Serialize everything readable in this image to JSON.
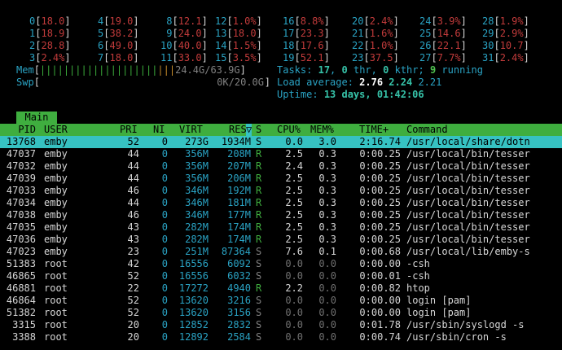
{
  "cpus": [
    {
      "id": "0",
      "val": "18.0"
    },
    {
      "id": "1",
      "val": "18.9"
    },
    {
      "id": "2",
      "val": "28.8"
    },
    {
      "id": "3",
      "val": "2.4%"
    },
    {
      "id": "4",
      "val": "19.0"
    },
    {
      "id": "5",
      "val": "38.2"
    },
    {
      "id": "6",
      "val": "49.0"
    },
    {
      "id": "7",
      "val": "18.0"
    },
    {
      "id": "8",
      "val": "12.1"
    },
    {
      "id": "9",
      "val": "24.0"
    },
    {
      "id": "10",
      "val": "40.0"
    },
    {
      "id": "11",
      "val": "33.0"
    },
    {
      "id": "12",
      "val": "1.0%"
    },
    {
      "id": "13",
      "val": "18.0"
    },
    {
      "id": "14",
      "val": "1.5%"
    },
    {
      "id": "15",
      "val": "3.5%"
    },
    {
      "id": "16",
      "val": "8.8%"
    },
    {
      "id": "17",
      "val": "23.3"
    },
    {
      "id": "18",
      "val": "17.6"
    },
    {
      "id": "19",
      "val": "52.1"
    },
    {
      "id": "20",
      "val": "2.4%"
    },
    {
      "id": "21",
      "val": "1.6%"
    },
    {
      "id": "22",
      "val": "1.0%"
    },
    {
      "id": "23",
      "val": "37.5"
    },
    {
      "id": "24",
      "val": "3.9%"
    },
    {
      "id": "25",
      "val": "14.6"
    },
    {
      "id": "26",
      "val": "22.1"
    },
    {
      "id": "27",
      "val": "7.7%"
    },
    {
      "id": "28",
      "val": "1.9%"
    },
    {
      "id": "29",
      "val": "2.9%"
    },
    {
      "id": "30",
      "val": "10.7"
    },
    {
      "id": "31",
      "val": "2.4%"
    }
  ],
  "mem": {
    "label": "Mem",
    "bars": "||||||||||||||||||||",
    "bars2": "|||",
    "value": "24.4G/63.9G"
  },
  "swp": {
    "label": "Swp",
    "value": "0K/20.0G"
  },
  "tasks": {
    "label": "Tasks:",
    "count": "17",
    "sep1": ",",
    "thr": "0",
    "thr_label": "thr,",
    "kthr": "0",
    "kthr_label": "kthr;",
    "running": "9",
    "running_label": "running"
  },
  "load": {
    "label": "Load average:",
    "l1": "2.76",
    "l5": "2.24",
    "l15": "2.21"
  },
  "uptime": {
    "label": "Uptime:",
    "value": "13 days, 01:42:06"
  },
  "tab": {
    "label": "Main"
  },
  "header": {
    "pid": "PID",
    "user": "USER",
    "pri": "PRI",
    "ni": "NI",
    "virt": "VIRT",
    "res": "RES",
    "sort": "▽",
    "s": "S",
    "cpu": "CPU%",
    "mem": "MEM%",
    "time": "TIME+",
    "cmd": "Command"
  },
  "processes": [
    {
      "pid": "13768",
      "user": "emby",
      "pri": "52",
      "ni": "0",
      "virt": "273G",
      "res": "1934M",
      "s": "S",
      "cpu": "0.0",
      "mem": "3.0",
      "time": "2:16.74",
      "cmd": "/usr/local/share/dotn"
    },
    {
      "pid": "47037",
      "user": "emby",
      "pri": "44",
      "ni": "0",
      "virt": "356M",
      "res": "208M",
      "s": "R",
      "cpu": "2.5",
      "mem": "0.3",
      "time": "0:00.25",
      "cmd": "/usr/local/bin/tesser"
    },
    {
      "pid": "47032",
      "user": "emby",
      "pri": "44",
      "ni": "0",
      "virt": "356M",
      "res": "207M",
      "s": "R",
      "cpu": "2.4",
      "mem": "0.3",
      "time": "0:00.25",
      "cmd": "/usr/local/bin/tesser"
    },
    {
      "pid": "47039",
      "user": "emby",
      "pri": "44",
      "ni": "0",
      "virt": "356M",
      "res": "206M",
      "s": "R",
      "cpu": "2.5",
      "mem": "0.3",
      "time": "0:00.25",
      "cmd": "/usr/local/bin/tesser"
    },
    {
      "pid": "47033",
      "user": "emby",
      "pri": "46",
      "ni": "0",
      "virt": "346M",
      "res": "192M",
      "s": "R",
      "cpu": "2.5",
      "mem": "0.3",
      "time": "0:00.25",
      "cmd": "/usr/local/bin/tesser"
    },
    {
      "pid": "47034",
      "user": "emby",
      "pri": "44",
      "ni": "0",
      "virt": "346M",
      "res": "181M",
      "s": "R",
      "cpu": "2.5",
      "mem": "0.3",
      "time": "0:00.25",
      "cmd": "/usr/local/bin/tesser"
    },
    {
      "pid": "47038",
      "user": "emby",
      "pri": "46",
      "ni": "0",
      "virt": "346M",
      "res": "177M",
      "s": "R",
      "cpu": "2.5",
      "mem": "0.3",
      "time": "0:00.25",
      "cmd": "/usr/local/bin/tesser"
    },
    {
      "pid": "47035",
      "user": "emby",
      "pri": "43",
      "ni": "0",
      "virt": "282M",
      "res": "174M",
      "s": "R",
      "cpu": "2.5",
      "mem": "0.3",
      "time": "0:00.25",
      "cmd": "/usr/local/bin/tesser"
    },
    {
      "pid": "47036",
      "user": "emby",
      "pri": "43",
      "ni": "0",
      "virt": "282M",
      "res": "174M",
      "s": "R",
      "cpu": "2.5",
      "mem": "0.3",
      "time": "0:00.25",
      "cmd": "/usr/local/bin/tesser"
    },
    {
      "pid": "47023",
      "user": "emby",
      "pri": "23",
      "ni": "0",
      "virt": "251M",
      "res": "87364",
      "s": "S",
      "cpu": "7.6",
      "mem": "0.1",
      "time": "0:00.68",
      "cmd": "/usr/local/lib/emby-s"
    },
    {
      "pid": "51383",
      "user": "root",
      "pri": "42",
      "ni": "0",
      "virt": "16556",
      "res": "6092",
      "s": "S",
      "cpu": "0.0",
      "mem": "0.0",
      "time": "0:00.00",
      "cmd": "-csh"
    },
    {
      "pid": "46865",
      "user": "root",
      "pri": "52",
      "ni": "0",
      "virt": "16556",
      "res": "6032",
      "s": "S",
      "cpu": "0.0",
      "mem": "0.0",
      "time": "0:00.01",
      "cmd": "-csh"
    },
    {
      "pid": "46881",
      "user": "root",
      "pri": "22",
      "ni": "0",
      "virt": "17272",
      "res": "4940",
      "s": "R",
      "cpu": "2.2",
      "mem": "0.0",
      "time": "0:00.82",
      "cmd": "htop"
    },
    {
      "pid": "46864",
      "user": "root",
      "pri": "52",
      "ni": "0",
      "virt": "13620",
      "res": "3216",
      "s": "S",
      "cpu": "0.0",
      "mem": "0.0",
      "time": "0:00.00",
      "cmd": "login [pam]"
    },
    {
      "pid": "51382",
      "user": "root",
      "pri": "52",
      "ni": "0",
      "virt": "13620",
      "res": "3156",
      "s": "S",
      "cpu": "0.0",
      "mem": "0.0",
      "time": "0:00.00",
      "cmd": "login [pam]"
    },
    {
      "pid": "3315",
      "user": "root",
      "pri": "20",
      "ni": "0",
      "virt": "12852",
      "res": "2832",
      "s": "S",
      "cpu": "0.0",
      "mem": "0.0",
      "time": "0:01.78",
      "cmd": "/usr/sbin/syslogd -s"
    },
    {
      "pid": "3388",
      "user": "root",
      "pri": "20",
      "ni": "0",
      "virt": "12892",
      "res": "2584",
      "s": "S",
      "cpu": "0.0",
      "mem": "0.0",
      "time": "0:00.74",
      "cmd": "/usr/sbin/cron -s"
    }
  ]
}
